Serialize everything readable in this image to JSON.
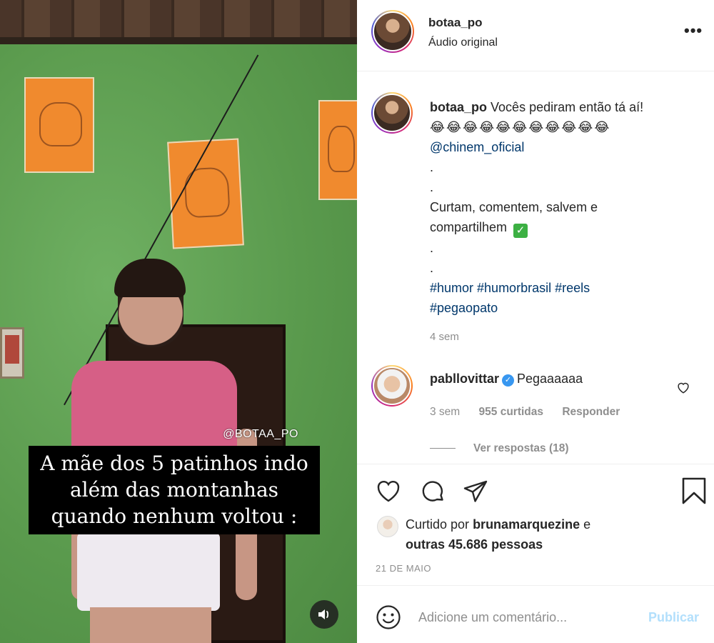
{
  "video": {
    "watermark": "@BOTAA_PO",
    "caption_lines": [
      "A mãe dos 5 patinhos indo",
      "além das montanhas",
      "quando nenhum voltou :"
    ],
    "sound_icon": "speaker-icon"
  },
  "header": {
    "username": "botaa_po",
    "subtitle": "Áudio original",
    "more_icon": "more-horizontal-icon",
    "more_label": "•••"
  },
  "caption": {
    "username": "botaa_po",
    "first_line": "Vocês pediram então tá aí!",
    "emojis": "😂😂😂😂😂😂😂😂😂😂😂",
    "mention": "@chinem_oficial",
    "dot1": ".",
    "dot2": ".",
    "cta_line1": "Curtam, comentem, salvem e",
    "cta_line2": "compartilhem",
    "cta_emoji": "✓",
    "dot3": ".",
    "dot4": ".",
    "hashtags_line1": "#humor #humorbrasil #reels",
    "hashtags_line2": "#pegaopato",
    "time": "4 sem"
  },
  "reply": {
    "username": "pabllovittar",
    "text": "Pegaaaaaa",
    "time": "3 sem",
    "likes": "955 curtidas",
    "reply_label": "Responder",
    "view_replies": "Ver respostas (18)"
  },
  "actions": {
    "liked_by_prefix": "Curtido por",
    "liked_by_user": "brunamarquezine",
    "liked_by_suffix": "e",
    "others": "outras 45.686 pessoas",
    "date": "21 DE MAIO"
  },
  "comment_box": {
    "placeholder": "Adicione um comentário...",
    "publish_label": "Publicar"
  },
  "colors": {
    "link": "#00376b",
    "muted": "#8e8e8e",
    "publish_disabled": "#b2dffc",
    "verified": "#3897f0"
  }
}
